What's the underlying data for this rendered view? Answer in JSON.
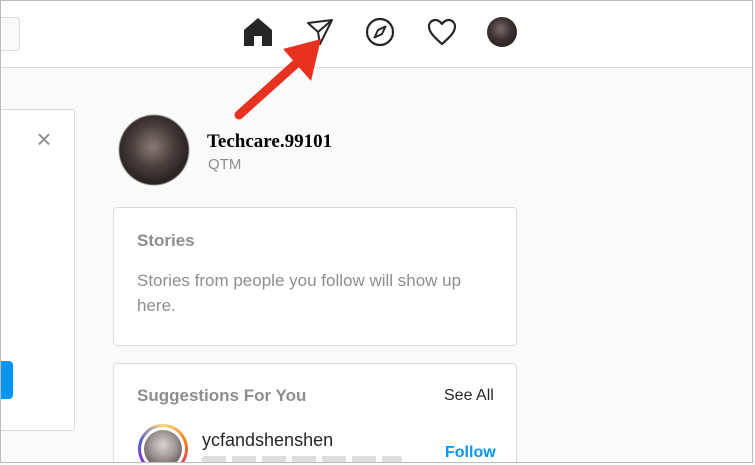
{
  "nav": {
    "icons": [
      "home-icon",
      "direct-message-icon",
      "explore-compass-icon",
      "activity-heart-icon",
      "profile-avatar"
    ]
  },
  "profile": {
    "username": "Techcare.99101",
    "fullname": "QTM"
  },
  "stories": {
    "title": "Stories",
    "empty_text": "Stories from people you follow will show up here."
  },
  "suggestions": {
    "title": "Suggestions For You",
    "see_all": "See All",
    "items": [
      {
        "username": "ycfandshenshen",
        "action": "Follow"
      }
    ]
  },
  "left_card": {
    "close_symbol": "×"
  },
  "colors": {
    "accent_blue": "#0095f6",
    "annotation_red": "#e8321f",
    "muted_text": "#8e8e8e",
    "border": "#dbdbdb"
  }
}
